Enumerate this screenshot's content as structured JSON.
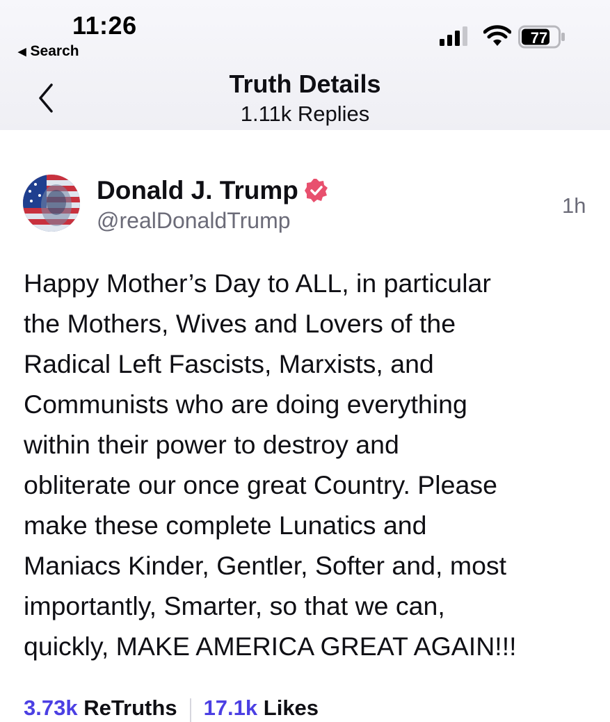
{
  "status_bar": {
    "time": "11:26",
    "back_app_label": "Search",
    "battery_level": "77"
  },
  "nav": {
    "title": "Truth Details",
    "subtitle": "1.11k Replies"
  },
  "post": {
    "author_name": "Donald J. Trump",
    "author_handle": "@realDonaldTrump",
    "age": "1h",
    "verified": true,
    "text": "Happy Mother’s Day to ALL, in particular\nthe Mothers, Wives and Lovers of the\nRadical Left Fascists, Marxists, and\nCommunists who are doing everything\nwithin their power to destroy and\nobliterate our once great Country. Please\nmake these complete Lunatics and\nManiacs Kinder, Gentler, Softer and, most\nimportantly, Smarter, so that we can,\nquickly, MAKE AMERICA GREAT AGAIN!!!"
  },
  "stats": {
    "retruths_count": "3.73k",
    "retruths_label": "ReTruths",
    "likes_count": "17.1k",
    "likes_label": "Likes"
  },
  "colors": {
    "accent": "#4b3fe3",
    "verified_badge": "#e8506e",
    "secondary_text": "#6b6b78"
  },
  "icons": [
    "back-arrow-icon",
    "signal-icon",
    "wifi-icon",
    "battery-icon",
    "chevron-left-icon",
    "verified-icon"
  ]
}
